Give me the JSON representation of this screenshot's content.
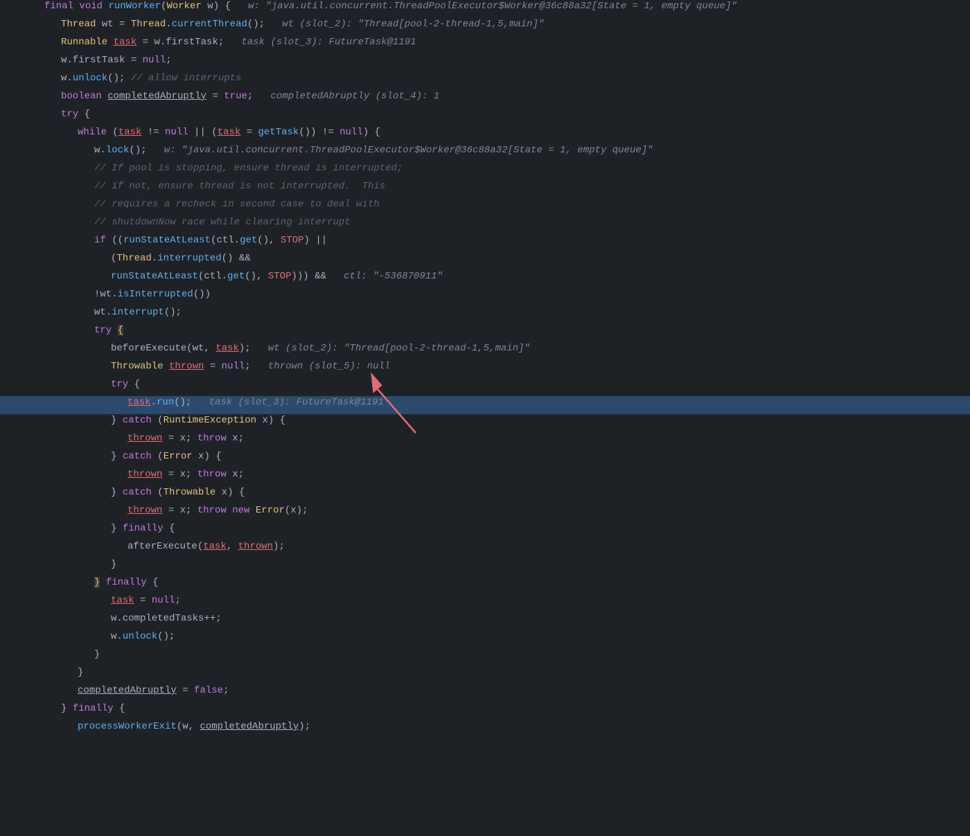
{
  "editor": {
    "background": "#1e2227",
    "highlighted_line": 22,
    "lines": [
      {
        "id": 1,
        "indent": 0,
        "parts": [
          {
            "t": "kw",
            "v": "final "
          },
          {
            "t": "kw",
            "v": "void "
          },
          {
            "t": "fn",
            "v": "runWorker"
          },
          {
            "t": "white",
            "v": "("
          },
          {
            "t": "type",
            "v": "Worker"
          },
          {
            "t": "white",
            "v": " w) {  "
          },
          {
            "t": "hint",
            "v": " w: \"java.util.concurrent.ThreadPoolExecutor$Worker@36c88a32[State = 1, empty queue]\""
          }
        ]
      },
      {
        "id": 2,
        "indent": 1,
        "parts": [
          {
            "t": "type",
            "v": "Thread"
          },
          {
            "t": "white",
            "v": " wt = "
          },
          {
            "t": "type",
            "v": "Thread"
          },
          {
            "t": "white",
            "v": "."
          },
          {
            "t": "fn",
            "v": "currentThread"
          },
          {
            "t": "white",
            "v": "();  "
          },
          {
            "t": "hint",
            "v": " wt (slot_2): \"Thread[pool-2-thread-1,5,main]\""
          }
        ]
      },
      {
        "id": 3,
        "indent": 1,
        "parts": [
          {
            "t": "type",
            "v": "Runnable"
          },
          {
            "t": "white",
            "v": " "
          },
          {
            "t": "var underline",
            "v": "task"
          },
          {
            "t": "white",
            "v": " = w.firstTask;  "
          },
          {
            "t": "hint",
            "v": " task (slot_3): FutureTask@1191"
          }
        ]
      },
      {
        "id": 4,
        "indent": 1,
        "parts": [
          {
            "t": "white",
            "v": "w.firstTask = "
          },
          {
            "t": "kw",
            "v": "null"
          },
          {
            "t": "white",
            "v": ";"
          }
        ]
      },
      {
        "id": 5,
        "indent": 1,
        "parts": [
          {
            "t": "white",
            "v": "w."
          },
          {
            "t": "fn",
            "v": "unlock"
          },
          {
            "t": "white",
            "v": "(); "
          },
          {
            "t": "comment",
            "v": "// allow interrupts"
          }
        ]
      },
      {
        "id": 6,
        "indent": 1,
        "parts": [
          {
            "t": "kw",
            "v": "boolean "
          },
          {
            "t": "white underline",
            "v": "completedAbruptly"
          },
          {
            "t": "white",
            "v": " = "
          },
          {
            "t": "kw",
            "v": "true"
          },
          {
            "t": "white",
            "v": ";  "
          },
          {
            "t": "hint",
            "v": " completedAbruptly (slot_4): 1"
          }
        ]
      },
      {
        "id": 7,
        "indent": 1,
        "parts": [
          {
            "t": "kw",
            "v": "try "
          },
          {
            "t": "white",
            "v": "{"
          }
        ]
      },
      {
        "id": 8,
        "indent": 2,
        "parts": [
          {
            "t": "kw",
            "v": "while "
          },
          {
            "t": "white",
            "v": "("
          },
          {
            "t": "var underline",
            "v": "task"
          },
          {
            "t": "white",
            "v": " != "
          },
          {
            "t": "kw",
            "v": "null"
          },
          {
            "t": "white",
            "v": " || ("
          },
          {
            "t": "var underline",
            "v": "task"
          },
          {
            "t": "white",
            "v": " = "
          },
          {
            "t": "fn",
            "v": "getTask"
          },
          {
            "t": "white",
            "v": "()) != "
          },
          {
            "t": "kw",
            "v": "null"
          },
          {
            "t": "white",
            "v": ") {"
          }
        ]
      },
      {
        "id": 9,
        "indent": 3,
        "parts": [
          {
            "t": "white",
            "v": "w."
          },
          {
            "t": "fn",
            "v": "lock"
          },
          {
            "t": "white",
            "v": "();  "
          },
          {
            "t": "hint",
            "v": " w: \"java.util.concurrent.ThreadPoolExecutor$Worker@36c88a32[State = 1, empty queue]\""
          }
        ]
      },
      {
        "id": 10,
        "indent": 3,
        "parts": [
          {
            "t": "comment",
            "v": "// If pool is stopping, ensure thread is interrupted;"
          }
        ]
      },
      {
        "id": 11,
        "indent": 3,
        "parts": [
          {
            "t": "comment",
            "v": "// if not, ensure thread is not interrupted.  This"
          }
        ]
      },
      {
        "id": 12,
        "indent": 3,
        "parts": [
          {
            "t": "comment",
            "v": "// requires a recheck in second case to deal with"
          }
        ]
      },
      {
        "id": 13,
        "indent": 3,
        "parts": [
          {
            "t": "comment",
            "v": "// shutdownNow race while clearing interrupt"
          }
        ]
      },
      {
        "id": 14,
        "indent": 3,
        "parts": [
          {
            "t": "kw",
            "v": "if "
          },
          {
            "t": "white",
            "v": "(("
          },
          {
            "t": "fn",
            "v": "runStateAtLeast"
          },
          {
            "t": "white",
            "v": "(ctl."
          },
          {
            "t": "fn",
            "v": "get"
          },
          {
            "t": "white",
            "v": "(), "
          },
          {
            "t": "var",
            "v": "STOP"
          },
          {
            "t": "white",
            "v": ") ||"
          }
        ]
      },
      {
        "id": 15,
        "indent": 4,
        "parts": [
          {
            "t": "white",
            "v": "("
          },
          {
            "t": "type",
            "v": "Thread"
          },
          {
            "t": "white",
            "v": "."
          },
          {
            "t": "fn",
            "v": "interrupted"
          },
          {
            "t": "white",
            "v": "() &&"
          }
        ]
      },
      {
        "id": 16,
        "indent": 4,
        "parts": [
          {
            "t": "fn",
            "v": "runStateAtLeast"
          },
          {
            "t": "white",
            "v": "(ctl."
          },
          {
            "t": "fn",
            "v": "get"
          },
          {
            "t": "white",
            "v": "(), "
          },
          {
            "t": "var",
            "v": "STOP"
          },
          {
            "t": "white",
            "v": "))) &&  "
          },
          {
            "t": "hint",
            "v": " ctl: \"-536870911\""
          }
        ]
      },
      {
        "id": 17,
        "indent": 3,
        "parts": [
          {
            "t": "white",
            "v": "!wt."
          },
          {
            "t": "fn",
            "v": "isInterrupted"
          },
          {
            "t": "white",
            "v": "())"
          }
        ]
      },
      {
        "id": 18,
        "indent": 3,
        "parts": [
          {
            "t": "white",
            "v": "wt."
          },
          {
            "t": "fn",
            "v": "interrupt"
          },
          {
            "t": "white",
            "v": "();"
          }
        ]
      },
      {
        "id": 19,
        "indent": 3,
        "parts": [
          {
            "t": "kw",
            "v": "try "
          },
          {
            "t": "highlight-bracket",
            "v": "{"
          }
        ]
      },
      {
        "id": 20,
        "indent": 4,
        "parts": [
          {
            "t": "white",
            "v": "beforeExecute(wt, "
          },
          {
            "t": "var underline",
            "v": "task"
          },
          {
            "t": "white",
            "v": ");  "
          },
          {
            "t": "hint",
            "v": " wt (slot_2): \"Thread[pool-2-thread-1,5,main]\""
          }
        ]
      },
      {
        "id": 21,
        "indent": 4,
        "parts": [
          {
            "t": "type",
            "v": "Throwable"
          },
          {
            "t": "white",
            "v": " "
          },
          {
            "t": "var underline",
            "v": "thrown"
          },
          {
            "t": "white",
            "v": " = "
          },
          {
            "t": "kw",
            "v": "null"
          },
          {
            "t": "white",
            "v": ";  "
          },
          {
            "t": "hint",
            "v": " thrown (slot_5): null"
          }
        ]
      },
      {
        "id": 22,
        "indent": 4,
        "parts": [
          {
            "t": "kw",
            "v": "try "
          },
          {
            "t": "white",
            "v": "{"
          }
        ]
      },
      {
        "id": 23,
        "indent": 5,
        "parts": [
          {
            "t": "var underline",
            "v": "task"
          },
          {
            "t": "white",
            "v": "."
          },
          {
            "t": "fn",
            "v": "run"
          },
          {
            "t": "white",
            "v": "();  "
          },
          {
            "t": "hint",
            "v": " task (slot_3): FutureTask@1191"
          }
        ],
        "highlighted": true
      },
      {
        "id": 24,
        "indent": 4,
        "parts": [
          {
            "t": "white",
            "v": "} "
          },
          {
            "t": "kw",
            "v": "catch "
          },
          {
            "t": "white",
            "v": "("
          },
          {
            "t": "type",
            "v": "RuntimeException"
          },
          {
            "t": "white",
            "v": " x) {"
          }
        ]
      },
      {
        "id": 25,
        "indent": 5,
        "parts": [
          {
            "t": "var underline",
            "v": "thrown"
          },
          {
            "t": "white",
            "v": " = x; "
          },
          {
            "t": "kw",
            "v": "throw"
          },
          {
            "t": "white",
            "v": " x;"
          }
        ]
      },
      {
        "id": 26,
        "indent": 4,
        "parts": [
          {
            "t": "white",
            "v": "} "
          },
          {
            "t": "kw",
            "v": "catch "
          },
          {
            "t": "white",
            "v": "("
          },
          {
            "t": "type",
            "v": "Error"
          },
          {
            "t": "white",
            "v": " x) {"
          }
        ]
      },
      {
        "id": 27,
        "indent": 5,
        "parts": [
          {
            "t": "var underline",
            "v": "thrown"
          },
          {
            "t": "white",
            "v": " = x; "
          },
          {
            "t": "kw",
            "v": "throw"
          },
          {
            "t": "white",
            "v": " x;"
          }
        ]
      },
      {
        "id": 28,
        "indent": 4,
        "parts": [
          {
            "t": "white",
            "v": "} "
          },
          {
            "t": "kw",
            "v": "catch "
          },
          {
            "t": "white",
            "v": "("
          },
          {
            "t": "type",
            "v": "Throwable"
          },
          {
            "t": "white",
            "v": " x) {"
          }
        ]
      },
      {
        "id": 29,
        "indent": 5,
        "parts": [
          {
            "t": "var underline",
            "v": "thrown"
          },
          {
            "t": "white",
            "v": " = x; "
          },
          {
            "t": "kw",
            "v": "throw new "
          },
          {
            "t": "type",
            "v": "Error"
          },
          {
            "t": "white",
            "v": "(x);"
          }
        ]
      },
      {
        "id": 30,
        "indent": 4,
        "parts": [
          {
            "t": "white",
            "v": "} "
          },
          {
            "t": "kw",
            "v": "finally "
          },
          {
            "t": "white",
            "v": "{"
          }
        ]
      },
      {
        "id": 31,
        "indent": 5,
        "parts": [
          {
            "t": "white",
            "v": "afterExecute("
          },
          {
            "t": "var underline",
            "v": "task"
          },
          {
            "t": "white",
            "v": ", "
          },
          {
            "t": "var underline",
            "v": "thrown"
          },
          {
            "t": "white",
            "v": ");"
          }
        ]
      },
      {
        "id": 32,
        "indent": 4,
        "parts": [
          {
            "t": "white",
            "v": "}"
          }
        ]
      },
      {
        "id": 33,
        "indent": 3,
        "parts": [
          {
            "t": "highlight-bracket",
            "v": "}"
          },
          {
            "t": "white",
            "v": " "
          },
          {
            "t": "kw",
            "v": "finally "
          },
          {
            "t": "white",
            "v": "{"
          }
        ]
      },
      {
        "id": 34,
        "indent": 4,
        "parts": [
          {
            "t": "var underline",
            "v": "task"
          },
          {
            "t": "white",
            "v": " = "
          },
          {
            "t": "kw",
            "v": "null"
          },
          {
            "t": "white",
            "v": ";"
          }
        ]
      },
      {
        "id": 35,
        "indent": 4,
        "parts": [
          {
            "t": "white",
            "v": "w.completedTasks++;"
          }
        ]
      },
      {
        "id": 36,
        "indent": 4,
        "parts": [
          {
            "t": "white",
            "v": "w."
          },
          {
            "t": "fn",
            "v": "unlock"
          },
          {
            "t": "white",
            "v": "();"
          }
        ]
      },
      {
        "id": 37,
        "indent": 3,
        "parts": [
          {
            "t": "white",
            "v": "}"
          }
        ]
      },
      {
        "id": 38,
        "indent": 2,
        "parts": [
          {
            "t": "white",
            "v": "}"
          }
        ]
      },
      {
        "id": 39,
        "indent": 2,
        "parts": [
          {
            "t": "white underline",
            "v": "completedAbruptly"
          },
          {
            "t": "white",
            "v": " = "
          },
          {
            "t": "kw",
            "v": "false"
          },
          {
            "t": "white",
            "v": ";"
          }
        ]
      },
      {
        "id": 40,
        "indent": 1,
        "parts": [
          {
            "t": "white",
            "v": "} "
          },
          {
            "t": "kw",
            "v": "finally "
          },
          {
            "t": "white",
            "v": "{"
          }
        ]
      },
      {
        "id": 41,
        "indent": 2,
        "parts": [
          {
            "t": "fn",
            "v": "processWorkerExit"
          },
          {
            "t": "white",
            "v": "(w, "
          },
          {
            "t": "white underline",
            "v": "completedAbruptly"
          },
          {
            "t": "white",
            "v": ");"
          }
        ]
      }
    ]
  }
}
